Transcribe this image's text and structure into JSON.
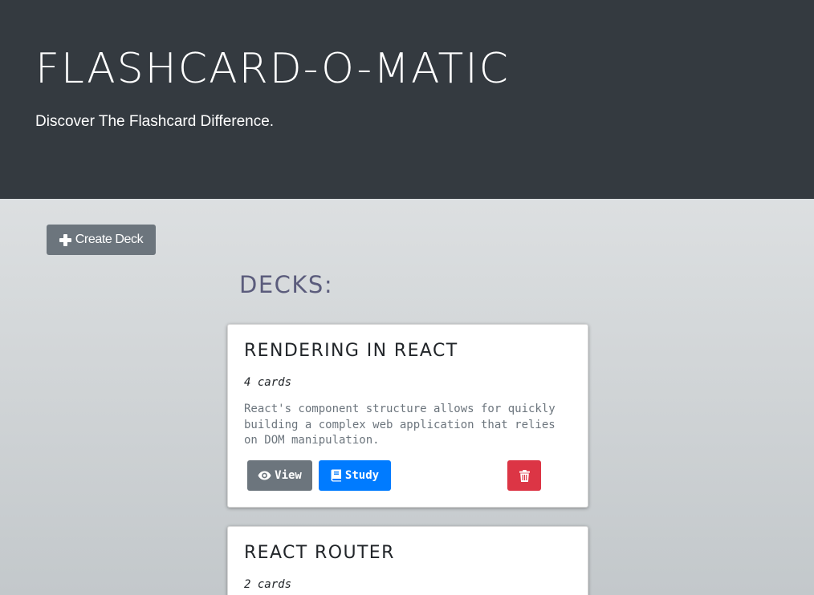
{
  "header": {
    "title": "FLASHCARD-O-MATIC",
    "subtitle": "Discover The Flashcard Difference."
  },
  "toolbar": {
    "create_deck_label": "Create Deck",
    "create_deck_icon": "plus-icon"
  },
  "main": {
    "heading": "DECKS:",
    "decks": [
      {
        "name": "RENDERING IN REACT",
        "count": "4 cards",
        "description": "React's component structure allows for quickly building a complex web application that relies on DOM manipulation.",
        "actions": {
          "view_label": "View",
          "view_icon": "eye-icon",
          "study_label": "Study",
          "study_icon": "book-icon",
          "delete_icon": "trash-icon"
        }
      },
      {
        "name": "REACT ROUTER",
        "count": "2 cards"
      }
    ]
  },
  "colors": {
    "header_bg": "#343a40",
    "secondary": "#6c757d",
    "primary": "#007bff",
    "danger": "#dc3545",
    "heading_accent": "#5b5c7c"
  }
}
